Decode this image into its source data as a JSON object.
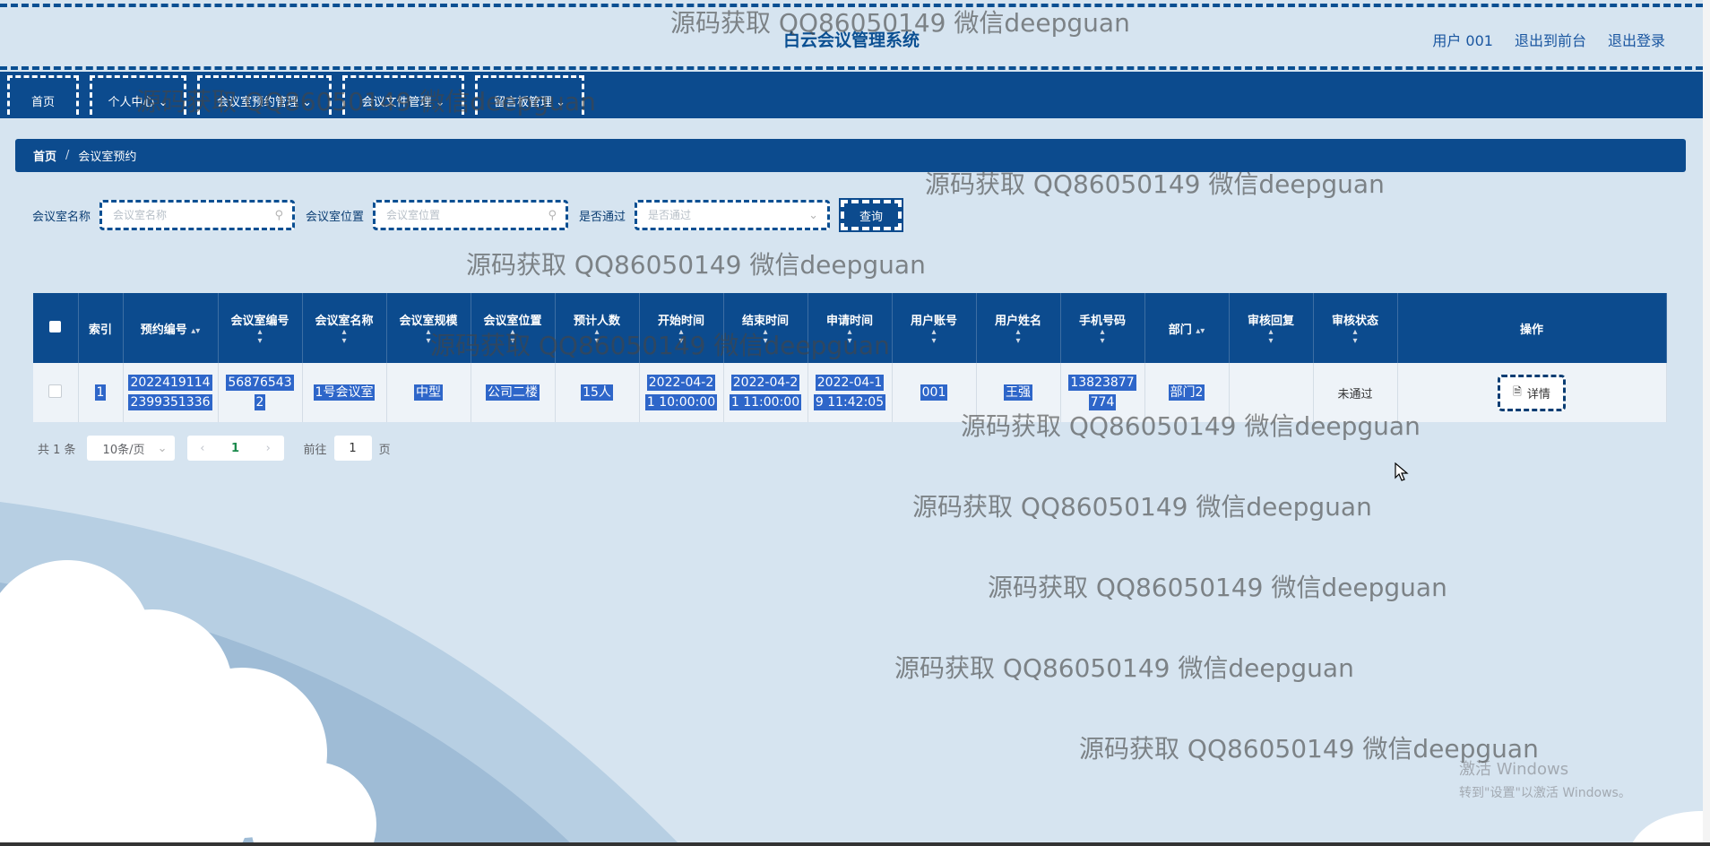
{
  "header": {
    "title": "白云会议管理系统",
    "links": [
      "用户 001",
      "退出到前台",
      "退出登录"
    ]
  },
  "nav": [
    {
      "label": "首页"
    },
    {
      "label": "个人中心 ⌄"
    },
    {
      "label": "会议室预约管理 ⌄"
    },
    {
      "label": "会议文件管理 ⌄"
    },
    {
      "label": "留言板管理 ⌄"
    }
  ],
  "breadcrumb": {
    "home": "首页",
    "sep": "/",
    "current": "会议室预约"
  },
  "search": {
    "name_label": "会议室名称",
    "name_placeholder": "会议室名称",
    "location_label": "会议室位置",
    "location_placeholder": "会议室位置",
    "approved_label": "是否通过",
    "approved_placeholder": "是否通过",
    "query_button": "查询"
  },
  "table": {
    "headers": [
      "索引",
      "预约编号",
      "会议室编号",
      "会议室名称",
      "会议室规模",
      "会议室位置",
      "预计人数",
      "开始时间",
      "结束时间",
      "申请时间",
      "用户账号",
      "用户姓名",
      "手机号码",
      "部门",
      "审核回复",
      "审核状态",
      "操作"
    ],
    "rows": [
      {
        "index": "1",
        "booking_no_1": "2022419114",
        "booking_no_2": "2399351336",
        "room_no_1": "56876543",
        "room_no_2": "2",
        "room_name": "1号会议室",
        "room_size": "中型",
        "room_location": "公司二楼",
        "people": "15人",
        "start_1": "2022-04-2",
        "start_2": "1 10:00:00",
        "end_1": "2022-04-2",
        "end_2": "1 11:00:00",
        "apply_1": "2022-04-1",
        "apply_2": "9 11:42:05",
        "account": "001",
        "user_name": "王强",
        "phone_1": "13823877",
        "phone_2": "774",
        "department": "部门2",
        "reply": "",
        "status": "未通过",
        "action": "详情"
      }
    ]
  },
  "pagination": {
    "total": "共 1 条",
    "page_size": "10条/页",
    "current_page": "1",
    "goto_prefix": "前往",
    "goto_value": "1",
    "goto_suffix": "页"
  },
  "watermark": "源码获取 QQ86050149 微信deepguan",
  "os_notice": {
    "line1": "激活 Windows",
    "line2": "转到\"设置\"以激活 Windows。"
  }
}
